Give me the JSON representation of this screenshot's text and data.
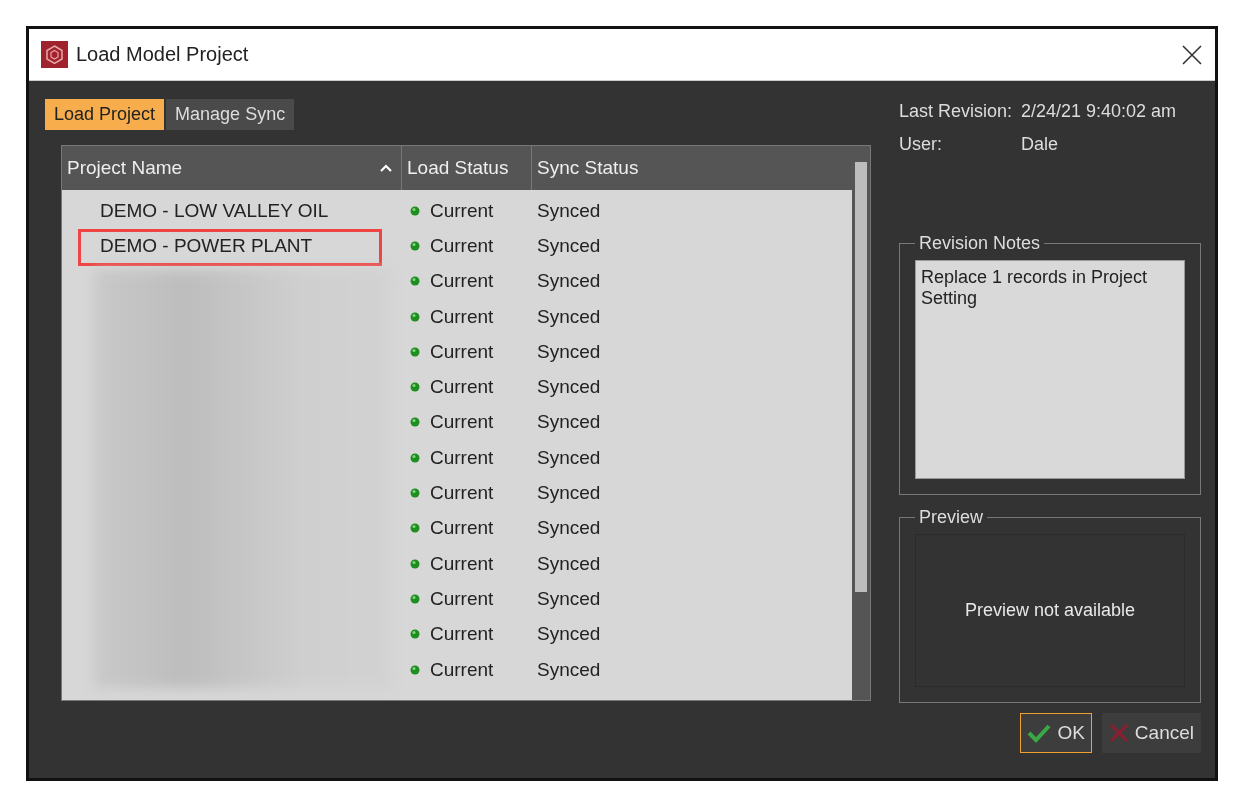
{
  "window": {
    "title": "Load Model Project"
  },
  "tabs": [
    {
      "label": "Load Project",
      "selected": true
    },
    {
      "label": "Manage Sync",
      "selected": false
    }
  ],
  "table": {
    "columns": [
      {
        "label": "Project Name",
        "sorted": true
      },
      {
        "label": "Load Status",
        "sorted": false
      },
      {
        "label": "Sync Status",
        "sorted": false
      }
    ],
    "rows": [
      {
        "name": "DEMO - LOW VALLEY OIL",
        "load_status": "Current",
        "sync_status": "Synced",
        "highlighted": false
      },
      {
        "name": "DEMO - POWER PLANT",
        "load_status": "Current",
        "sync_status": "Synced",
        "highlighted": true
      },
      {
        "load_status": "Current",
        "sync_status": "Synced",
        "highlighted": false
      },
      {
        "load_status": "Current",
        "sync_status": "Synced",
        "highlighted": false
      },
      {
        "load_status": "Current",
        "sync_status": "Synced",
        "highlighted": false
      },
      {
        "load_status": "Current",
        "sync_status": "Synced",
        "highlighted": false
      },
      {
        "load_status": "Current",
        "sync_status": "Synced",
        "highlighted": false
      },
      {
        "load_status": "Current",
        "sync_status": "Synced",
        "highlighted": false
      },
      {
        "load_status": "Current",
        "sync_status": "Synced",
        "highlighted": false
      },
      {
        "load_status": "Current",
        "sync_status": "Synced",
        "highlighted": false
      },
      {
        "load_status": "Current",
        "sync_status": "Synced",
        "highlighted": false
      },
      {
        "load_status": "Current",
        "sync_status": "Synced",
        "highlighted": false
      },
      {
        "load_status": "Current",
        "sync_status": "Synced",
        "highlighted": false
      },
      {
        "load_status": "Current",
        "sync_status": "Synced",
        "highlighted": false
      }
    ]
  },
  "details": [
    {
      "label": "Last Revision:",
      "value": "2/24/21 9:40:02 am"
    },
    {
      "label": "User:",
      "value": "Dale"
    }
  ],
  "revision_notes": {
    "title": "Revision Notes",
    "text": "Replace 1 records in Project Setting"
  },
  "preview": {
    "title": "Preview",
    "message": "Preview not available"
  },
  "buttons": [
    {
      "label": "OK",
      "kind": "ok",
      "focused": true
    },
    {
      "label": "Cancel",
      "kind": "cancel",
      "focused": false
    }
  ]
}
